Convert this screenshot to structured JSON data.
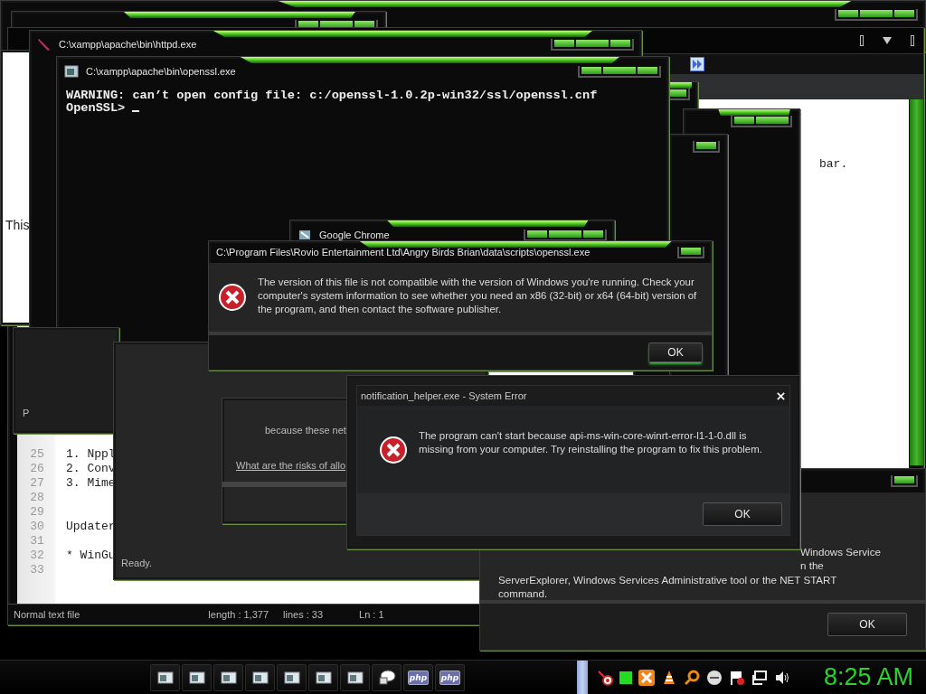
{
  "windows": [
    {
      "kind": "frame"
    },
    {
      "kind": "frame"
    },
    {
      "kind": "editor",
      "fragment": "bar.",
      "lines": [
        {
          "number": "25",
          "text": "1.   Nppl"
        },
        {
          "number": "26",
          "text": "2.   Conv"
        },
        {
          "number": "27",
          "text": "3.   Mime"
        },
        {
          "number": "28"
        },
        {
          "number": "29"
        },
        {
          "number": "30",
          "text": "Updater"
        },
        {
          "number": "31"
        },
        {
          "number": "32",
          "text": "* WinGu"
        },
        {
          "number": "33"
        }
      ],
      "status": [
        "Normal text file",
        "length : 1,377",
        "lines : 33",
        "Ln : 1"
      ]
    },
    {
      "kind": "browser",
      "text": "This"
    },
    {
      "kind": "console",
      "title": "C:\\xampp\\apache\\bin\\httpd.exe"
    },
    {
      "kind": "frame"
    },
    {
      "kind": "frame"
    },
    {
      "kind": "frame"
    },
    {
      "kind": "console",
      "title": "C:\\xampp\\apache\\bin\\openssl.exe",
      "lines": [
        "WARNING: can’t open config file: c:/openssl-1.0.2p-win32/ssl/openssl.cnf",
        "OpenSSL> "
      ]
    },
    {
      "kind": "labeled",
      "text": "P"
    },
    {
      "kind": "status",
      "text": "Ready."
    },
    {
      "kind": "titled",
      "title": "Google Chrome"
    },
    {
      "kind": "error",
      "title": "C:\\Program Files\\Rovio Entertainment Ltd\\Angry Birds Brian\\data\\scripts\\openssl.exe",
      "message": "The version of this file is not compatible with the version of Windows you're running. Check your computer's system information to see whether you need an x86 (32-bit) or x64 (64-bit) version of the program, and then contact the software publisher.",
      "button": "OK"
    },
    {
      "kind": "firewall",
      "text": "because these net",
      "link": "What are the risks of allo"
    },
    {
      "kind": "notice",
      "lines": [
        "Windows Service",
        "n the",
        "ServerExplorer, Windows Services Administrative tool or the NET START",
        "command."
      ],
      "button": "OK"
    },
    {
      "kind": "system_error",
      "title": "notification_helper.exe - System Error",
      "message": "The program can't start because api-ms-win-core-winrt-error-l1-1-0.dll is missing from your computer. Try reinstalling the program to fix this problem.",
      "button": "OK"
    }
  ],
  "taskbar": {
    "buttons": [
      {
        "kind": "window"
      },
      {
        "kind": "window"
      },
      {
        "kind": "window"
      },
      {
        "kind": "window"
      },
      {
        "kind": "window"
      },
      {
        "kind": "window"
      },
      {
        "kind": "window"
      },
      {
        "kind": "chat"
      },
      {
        "kind": "php",
        "label": "php"
      },
      {
        "kind": "php",
        "label": "php"
      }
    ],
    "clock": "8:25 AM"
  }
}
